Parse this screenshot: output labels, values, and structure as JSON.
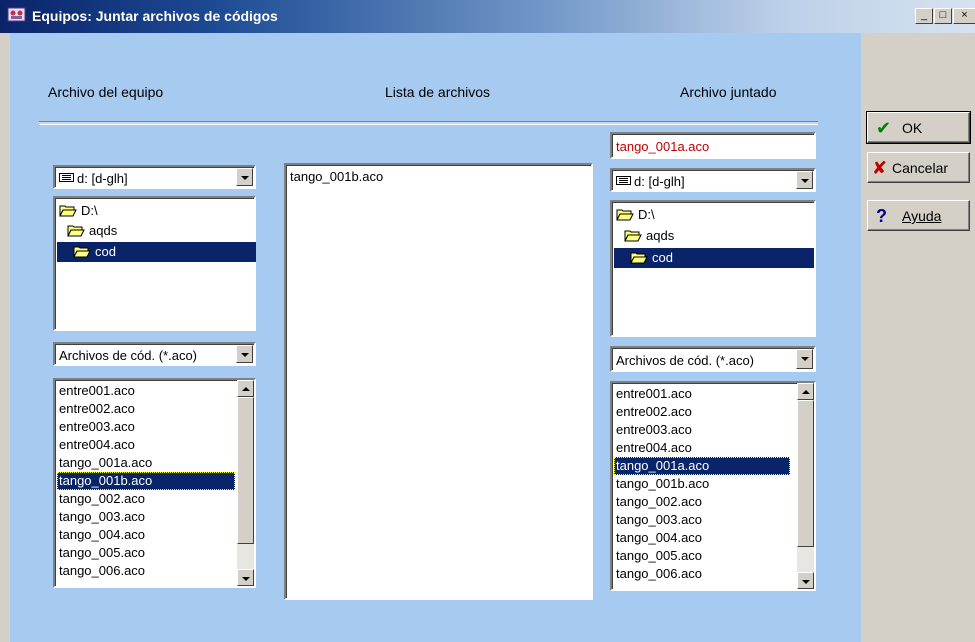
{
  "window": {
    "title": "Equipos: Juntar archivos de códigos",
    "minimize": "_",
    "maximize": "□",
    "close": "×"
  },
  "headers": {
    "left": "Archivo del equipo",
    "middle": "Lista de archivos",
    "right": "Archivo juntado"
  },
  "left": {
    "drive": "d: [d-glh]",
    "dirs": [
      "D:\\",
      "aqds",
      "cod"
    ],
    "selected_dir": "cod",
    "filter": "Archivos de cód. (*.aco)",
    "files": [
      "entre001.aco",
      "entre002.aco",
      "entre003.aco",
      "entre004.aco",
      "tango_001a.aco",
      "tango_001b.aco",
      "tango_002.aco",
      "tango_003.aco",
      "tango_004.aco",
      "tango_005.aco",
      "tango_006.aco"
    ],
    "selected_file": "tango_001b.aco"
  },
  "middle": {
    "files": [
      "tango_001b.aco"
    ]
  },
  "right": {
    "output_filename": "tango_001a.aco",
    "output_color": "#c00000",
    "drive": "d: [d-glh]",
    "dirs": [
      "D:\\",
      "aqds",
      "cod"
    ],
    "selected_dir": "cod",
    "filter": "Archivos de cód. (*.aco)",
    "files": [
      "entre001.aco",
      "entre002.aco",
      "entre003.aco",
      "entre004.aco",
      "tango_001a.aco",
      "tango_001b.aco",
      "tango_002.aco",
      "tango_003.aco",
      "tango_004.aco",
      "tango_005.aco",
      "tango_006.aco"
    ],
    "selected_file": "tango_001a.aco"
  },
  "buttons": {
    "ok": {
      "label": "OK",
      "icon": "checkmark-icon",
      "color": "#008000"
    },
    "cancel": {
      "label": "Cancelar",
      "icon": "x-icon",
      "color": "#c00000"
    },
    "help": {
      "label": "Ayuda",
      "icon": "question-icon",
      "color": "#000080"
    }
  },
  "colors": {
    "client_bg": "#a6caf0",
    "selection": "#0a246a",
    "face": "#d4d0c8"
  }
}
